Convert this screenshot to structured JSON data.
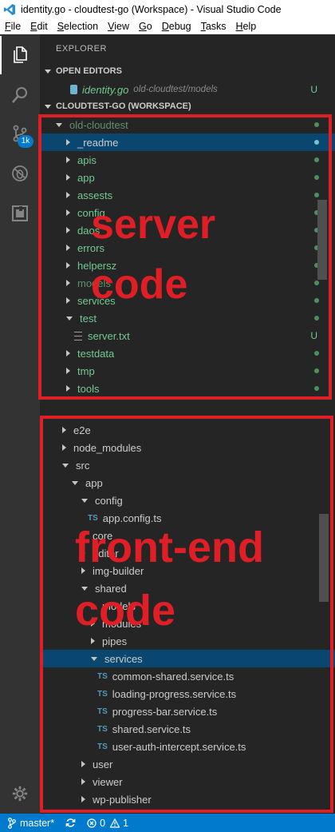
{
  "window": {
    "title": "identity.go - cloudtest-go (Workspace) - Visual Studio Code"
  },
  "menu": [
    {
      "underline": "F",
      "rest": "ile"
    },
    {
      "underline": "E",
      "rest": "dit"
    },
    {
      "underline": "S",
      "rest": "election"
    },
    {
      "underline": "V",
      "rest": "iew"
    },
    {
      "underline": "G",
      "rest": "o"
    },
    {
      "underline": "D",
      "rest": "ebug"
    },
    {
      "underline": "T",
      "rest": "asks"
    },
    {
      "underline": "H",
      "rest": "elp"
    }
  ],
  "activity": {
    "scm_badge": "1k"
  },
  "explorer": {
    "title": "EXPLORER",
    "open_editors_header": "OPEN EDITORS",
    "open_editor": {
      "name": "identity.go",
      "path": "old-cloudtest/models",
      "status": "U"
    },
    "workspace_header": "CLOUDTEST-GO (WORKSPACE)"
  },
  "server_tree": [
    {
      "label": "old-cloudtest",
      "expanded": true
    },
    {
      "label": "_readme"
    },
    {
      "label": "apis"
    },
    {
      "label": "app"
    },
    {
      "label": "assests"
    },
    {
      "label": "config"
    },
    {
      "label": "daos"
    },
    {
      "label": "errors"
    },
    {
      "label": "helpersz"
    },
    {
      "label": "models"
    },
    {
      "label": "services"
    },
    {
      "label": "test",
      "expanded": true
    },
    {
      "label": "server.txt",
      "status": "U"
    },
    {
      "label": "testdata"
    },
    {
      "label": "tmp"
    },
    {
      "label": "tools"
    }
  ],
  "client_tree": [
    {
      "label": "e2e"
    },
    {
      "label": "node_modules"
    },
    {
      "label": "src",
      "expanded": true
    },
    {
      "label": "app",
      "expanded": true
    },
    {
      "label": "config",
      "expanded": true
    },
    {
      "label": "app.config.ts",
      "file_type": "TS"
    },
    {
      "label": "core"
    },
    {
      "label": "editor"
    },
    {
      "label": "img-builder"
    },
    {
      "label": "shared",
      "expanded": true
    },
    {
      "label": "models"
    },
    {
      "label": "modules"
    },
    {
      "label": "pipes"
    },
    {
      "label": "services",
      "expanded": true
    },
    {
      "label": "common-shared.service.ts",
      "file_type": "TS"
    },
    {
      "label": "loading-progress.service.ts",
      "file_type": "TS"
    },
    {
      "label": "progress-bar.service.ts",
      "file_type": "TS"
    },
    {
      "label": "shared.service.ts",
      "file_type": "TS"
    },
    {
      "label": "user-auth-intercept.service.ts",
      "file_type": "TS"
    },
    {
      "label": "user"
    },
    {
      "label": "viewer"
    },
    {
      "label": "wp-publisher"
    }
  ],
  "annotations": {
    "server_line1": "server",
    "server_line2": "code",
    "client_line1": "front-end",
    "client_line2": "code",
    "color": "#e01e25"
  },
  "statusbar": {
    "branch": "master*",
    "errors": "0",
    "warnings": "1"
  },
  "colors": {
    "accent": "#007acc",
    "sidebar": "#252526",
    "activitybar": "#333333",
    "selection": "#094771",
    "git_added": "#73c991"
  }
}
